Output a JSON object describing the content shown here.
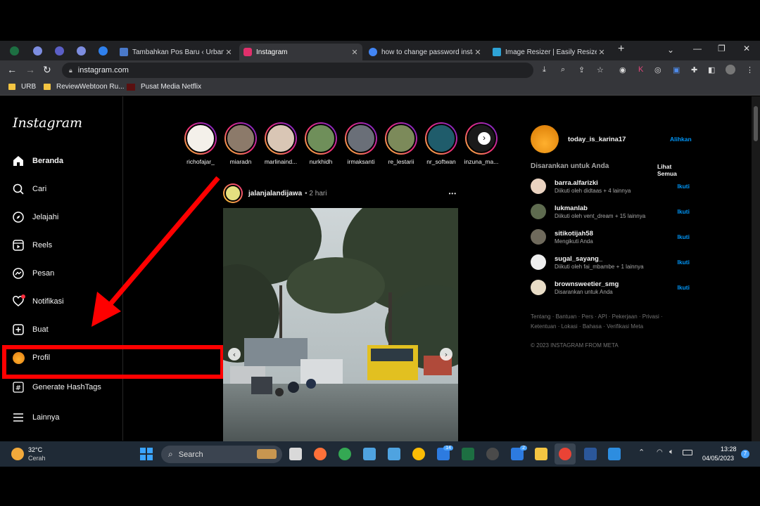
{
  "browser": {
    "tabs": [
      {
        "title": "Tambahkan Pos Baru ‹ Urband",
        "favicon_color": "#4a79c9"
      },
      {
        "title": "Instagram",
        "favicon_color": "#e1306c"
      },
      {
        "title": "how to change password insta",
        "favicon_color": "#4285f4"
      },
      {
        "title": "Image Resizer | Easily Resize Im",
        "favicon_color": "#2ea3d6"
      }
    ],
    "active_tab": "Instagram",
    "url": "instagram.com",
    "bookmarks": [
      "URB",
      "ReviewWebtoon Ru...",
      "Pusat Media Netflix"
    ]
  },
  "instagram": {
    "logo": "Instagram",
    "nav": [
      {
        "label": "Beranda",
        "icon": "home-icon",
        "bold": true
      },
      {
        "label": "Cari",
        "icon": "search-icon"
      },
      {
        "label": "Jelajahi",
        "icon": "compass-icon"
      },
      {
        "label": "Reels",
        "icon": "reels-icon"
      },
      {
        "label": "Pesan",
        "icon": "messenger-icon"
      },
      {
        "label": "Notifikasi",
        "icon": "heart-icon"
      },
      {
        "label": "Buat",
        "icon": "plus-square-icon"
      },
      {
        "label": "Profil",
        "icon": "avatar-icon"
      },
      {
        "label": "Generate HashTags",
        "icon": "hashtag-icon"
      },
      {
        "label": "Lainnya",
        "icon": "menu-icon"
      }
    ],
    "stories": [
      {
        "name": "richofajar_",
        "color": "#f4f0ea"
      },
      {
        "name": "miaradn",
        "color": "#8c7a6a"
      },
      {
        "name": "marlinaind...",
        "color": "#d9c6b5"
      },
      {
        "name": "nurkhidh",
        "color": "#6f8f5a"
      },
      {
        "name": "irmaksanti",
        "color": "#6a6f78"
      },
      {
        "name": "re_lestarii",
        "color": "#7c8a5a"
      },
      {
        "name": "nr_softwan",
        "color": "#1f5c6b"
      },
      {
        "name": "inzuna_ma...",
        "color": "#1a1a1a"
      }
    ],
    "post": {
      "username": "jalanjalandijawa",
      "time": "• 2 hari",
      "more": "•••"
    },
    "account": {
      "username": "today_is_karina17",
      "switch": "Alihkan"
    },
    "suggest_title": "Disarankan untuk Anda",
    "see_all": "Lihat Semua",
    "suggestions": [
      {
        "username": "barra.alfarizki",
        "reason": "Diikuti oleh didtaas + 4 lainnya",
        "action": "Ikuti",
        "color": "#e9d2c0"
      },
      {
        "username": "lukmanlab",
        "reason": "Diikuti oleh vent_dream + 15 lainnya",
        "action": "Ikuti",
        "color": "#5e6b4f"
      },
      {
        "username": "sitikotijah58",
        "reason": "Mengikuti Anda",
        "action": "Ikuti",
        "color": "#6f6a5c"
      },
      {
        "username": "sugal_sayang_",
        "reason": "Diikuti oleh fai_mbambe + 1 lainnya",
        "action": "Ikuti",
        "color": "#eeeeee"
      },
      {
        "username": "brownsweetier_smg",
        "reason": "Disarankan untuk Anda",
        "action": "Ikuti",
        "color": "#e8dcc6"
      }
    ],
    "footer_line1": "Tentang · Bantuan · Pers · API · Pekerjaan · Privasi ·",
    "footer_line2": "Ketentuan · Lokasi · Bahasa · Verifikasi Meta",
    "copyright": "© 2023 INSTAGRAM FROM META"
  },
  "taskbar": {
    "weather_temp": "32°C",
    "weather_desc": "Cerah",
    "search": "Search",
    "badge_14": "14",
    "badge_2": "2",
    "time": "13:28",
    "date": "04/05/2023",
    "notif": "7"
  }
}
